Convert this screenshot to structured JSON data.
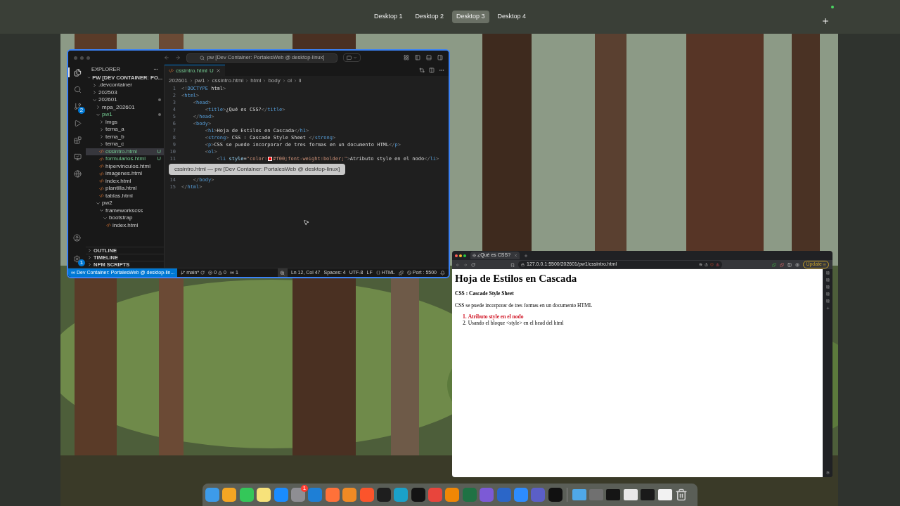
{
  "spaces": [
    {
      "label": "Desktop 1",
      "selected": false
    },
    {
      "label": "Desktop 2",
      "selected": false
    },
    {
      "label": "Desktop 3",
      "selected": true
    },
    {
      "label": "Desktop 4",
      "selected": false
    }
  ],
  "vscode": {
    "command_center": "pw [Dev Container: PortalesWeb @ desktop-linux]",
    "activity_bar": [
      {
        "kind": "files",
        "selected": true
      },
      {
        "kind": "search",
        "selected": false
      },
      {
        "kind": "source-control",
        "selected": false,
        "badge": "2"
      },
      {
        "kind": "run",
        "selected": false
      },
      {
        "kind": "extensions",
        "selected": false
      },
      {
        "kind": "remote",
        "selected": false
      },
      {
        "kind": "browser",
        "selected": false
      }
    ],
    "activity_bottom": [
      {
        "kind": "account"
      },
      {
        "kind": "settings",
        "badge": "1"
      }
    ],
    "explorer": {
      "title": "EXPLORER",
      "root": "PW [DEV CONTAINER: PO...",
      "tree": [
        {
          "label": ".devcontainer",
          "kind": "folder",
          "expanded": false,
          "selected": false
        },
        {
          "label": "202503",
          "kind": "folder",
          "expanded": false,
          "selected": false
        },
        {
          "label": "202601",
          "kind": "folder",
          "expanded": true,
          "selected": false,
          "dot": true,
          "children": [
            {
              "label": "mpa_202601",
              "kind": "folder",
              "expanded": false,
              "selected": false
            },
            {
              "label": "pw1",
              "kind": "folder",
              "expanded": true,
              "selected": false,
              "dot": true,
              "untracked": true,
              "children": [
                {
                  "label": "imgs",
                  "kind": "folder",
                  "expanded": false,
                  "selected": false
                },
                {
                  "label": "tema_a",
                  "kind": "folder",
                  "expanded": false,
                  "selected": false
                },
                {
                  "label": "tema_b",
                  "kind": "folder",
                  "expanded": false,
                  "selected": false
                },
                {
                  "label": "tema_c",
                  "kind": "folder",
                  "expanded": false,
                  "selected": false
                },
                {
                  "label": "cssintro.html",
                  "kind": "file",
                  "selected": true,
                  "untracked": true,
                  "status": "U"
                },
                {
                  "label": "formularios.html",
                  "kind": "file",
                  "selected": false,
                  "untracked": true,
                  "status": "U"
                },
                {
                  "label": "hipervinculos.html",
                  "kind": "file",
                  "selected": false
                },
                {
                  "label": "imagenes.html",
                  "kind": "file",
                  "selected": false
                },
                {
                  "label": "index.html",
                  "kind": "file",
                  "selected": false
                },
                {
                  "label": "plantilla.html",
                  "kind": "file",
                  "selected": false
                },
                {
                  "label": "tablas.html",
                  "kind": "file",
                  "selected": false
                }
              ]
            },
            {
              "label": "pw2",
              "kind": "folder",
              "expanded": true,
              "selected": false,
              "children": [
                {
                  "label": "frameworkscss",
                  "kind": "folder",
                  "expanded": true,
                  "selected": false,
                  "children": [
                    {
                      "label": "bootstrap",
                      "kind": "folder",
                      "expanded": true,
                      "selected": false,
                      "children": [
                        {
                          "label": "index.html",
                          "kind": "file",
                          "selected": false
                        }
                      ]
                    }
                  ]
                }
              ]
            }
          ]
        }
      ],
      "sections": [
        "OUTLINE",
        "TIMELINE",
        "NPM SCRIPTS"
      ]
    },
    "tab": {
      "label": "cssintro.html",
      "status": "U"
    },
    "breadcrumbs": [
      "202601",
      "pw1",
      "cssintro.html",
      "html",
      "body",
      "ol",
      "li"
    ],
    "lines": [
      {
        "kind": "code",
        "number": "1",
        "tokens": [
          {
            "kind": "punct",
            "t": "<!"
          },
          {
            "kind": "tag",
            "t": "DOCTYPE"
          },
          {
            "kind": "text",
            "t": " html"
          },
          {
            "kind": "punct",
            "t": ">"
          }
        ]
      },
      {
        "kind": "code",
        "number": "2",
        "tokens": [
          {
            "kind": "punct",
            "t": "<"
          },
          {
            "kind": "tag",
            "t": "html"
          },
          {
            "kind": "punct",
            "t": ">"
          }
        ]
      },
      {
        "kind": "code",
        "number": "3",
        "tokens": [
          {
            "kind": "punct",
            "t": "    <"
          },
          {
            "kind": "tag",
            "t": "head"
          },
          {
            "kind": "punct",
            "t": ">"
          }
        ]
      },
      {
        "kind": "code",
        "number": "4",
        "tokens": [
          {
            "kind": "punct",
            "t": "        <"
          },
          {
            "kind": "tag",
            "t": "title"
          },
          {
            "kind": "punct",
            "t": ">"
          },
          {
            "kind": "text",
            "t": "¿Qué es CSS?"
          },
          {
            "kind": "punct",
            "t": "</"
          },
          {
            "kind": "tag",
            "t": "title"
          },
          {
            "kind": "punct",
            "t": ">"
          }
        ]
      },
      {
        "kind": "code",
        "number": "5",
        "tokens": [
          {
            "kind": "punct",
            "t": "    </"
          },
          {
            "kind": "tag",
            "t": "head"
          },
          {
            "kind": "punct",
            "t": ">"
          }
        ]
      },
      {
        "kind": "code",
        "number": "6",
        "tokens": [
          {
            "kind": "punct",
            "t": "    <"
          },
          {
            "kind": "tag",
            "t": "body"
          },
          {
            "kind": "punct",
            "t": ">"
          }
        ]
      },
      {
        "kind": "code",
        "number": "7",
        "tokens": [
          {
            "kind": "punct",
            "t": "        <"
          },
          {
            "kind": "tag",
            "t": "h1"
          },
          {
            "kind": "punct",
            "t": ">"
          },
          {
            "kind": "text",
            "t": "Hoja de Estilos en Cascada"
          },
          {
            "kind": "punct",
            "t": "</"
          },
          {
            "kind": "tag",
            "t": "h1"
          },
          {
            "kind": "punct",
            "t": ">"
          }
        ]
      },
      {
        "kind": "code",
        "number": "8",
        "tokens": [
          {
            "kind": "punct",
            "t": "        <"
          },
          {
            "kind": "tag",
            "t": "strong"
          },
          {
            "kind": "punct",
            "t": ">"
          },
          {
            "kind": "text",
            "t": " CSS : Cascade Style Sheet "
          },
          {
            "kind": "punct",
            "t": "</"
          },
          {
            "kind": "tag",
            "t": "strong"
          },
          {
            "kind": "punct",
            "t": ">"
          }
        ]
      },
      {
        "kind": "code",
        "number": "9",
        "tokens": [
          {
            "kind": "punct",
            "t": "        <"
          },
          {
            "kind": "tag",
            "t": "p"
          },
          {
            "kind": "punct",
            "t": ">"
          },
          {
            "kind": "text",
            "t": "CSS se puede incorporar de tres formas en un documento HTML"
          },
          {
            "kind": "punct",
            "t": "</"
          },
          {
            "kind": "tag",
            "t": "p"
          },
          {
            "kind": "punct",
            "t": ">"
          }
        ]
      },
      {
        "kind": "code",
        "number": "10",
        "tokens": [
          {
            "kind": "punct",
            "t": "        <"
          },
          {
            "kind": "tag",
            "t": "ol"
          },
          {
            "kind": "punct",
            "t": ">"
          }
        ]
      },
      {
        "kind": "code",
        "number": "11",
        "tokens": [
          {
            "kind": "punct",
            "t": "            <"
          },
          {
            "kind": "tag",
            "t": "li"
          },
          {
            "kind": "attr",
            "t": " style"
          },
          {
            "kind": "text",
            "t": "="
          },
          {
            "kind": "str",
            "t": "\"color:"
          },
          {
            "kind": "swatch",
            "color": "#ff0000"
          },
          {
            "kind": "str",
            "t": "#f00;font-weight:bolder;\""
          },
          {
            "kind": "punct",
            "t": ">"
          },
          {
            "kind": "text",
            "t": "Atributo style en el nodo"
          },
          {
            "kind": "punct",
            "t": "</"
          },
          {
            "kind": "tag",
            "t": "li"
          },
          {
            "kind": "punct",
            "t": ">"
          }
        ]
      },
      {
        "kind": "tooltip",
        "text": "cssintro.html — pw [Dev Container: PortalesWeb @ desktop-linux]"
      },
      {
        "kind": "code",
        "number": "14",
        "tokens": [
          {
            "kind": "punct",
            "t": "    </"
          },
          {
            "kind": "tag",
            "t": "body"
          },
          {
            "kind": "punct",
            "t": ">"
          }
        ]
      },
      {
        "kind": "code",
        "number": "15",
        "tokens": [
          {
            "kind": "punct",
            "t": "</"
          },
          {
            "kind": "tag",
            "t": "html"
          },
          {
            "kind": "punct",
            "t": ">"
          }
        ]
      }
    ],
    "status_bar": {
      "remote": "Dev Container: PortalesWeb @ desktop-lin...",
      "branch": "main*",
      "errors": "0",
      "warnings": "0",
      "ports": "1",
      "position": "Ln 12, Col 47",
      "spaces": "Spaces: 4",
      "encoding": "UTF-8",
      "eol": "LF",
      "language": "HTML",
      "port": "Port : 5500"
    }
  },
  "browser": {
    "tab": "¿Qué es CSS?",
    "url": "127.0.0.1:5500/202601/pw1/cssintro.html",
    "update": "Update",
    "page": {
      "heading": "Hoja de Estilos en Cascada",
      "strong": "CSS : Cascade Style Sheet",
      "paragraph": "CSS se puede incorporar de tres formas en un documento HTML",
      "list": [
        {
          "number": "1.",
          "text": "Atributo style en el nodo",
          "kind": "styled"
        },
        {
          "number": "2.",
          "text": "Usando el bloque <style> en el head del html",
          "kind": "plain"
        }
      ]
    }
  },
  "dock": {
    "apps": [
      {
        "color": "#3d9be9"
      },
      {
        "color": "#f5a623"
      },
      {
        "color": "#34c759"
      },
      {
        "color": "#f7e27a"
      },
      {
        "color": "#1a8cff"
      },
      {
        "color": "#8e8e93",
        "badge": "1"
      },
      {
        "color": "#1e7fd6"
      },
      {
        "color": "#ff7139"
      },
      {
        "color": "#f08a24"
      },
      {
        "color": "#fb542b"
      },
      {
        "color": "#1e1e1e"
      },
      {
        "color": "#1aa1c9"
      },
      {
        "color": "#141414"
      },
      {
        "color": "#e8453c"
      },
      {
        "color": "#f08705"
      },
      {
        "color": "#1f7244"
      },
      {
        "color": "#7c5ad6"
      },
      {
        "color": "#2b66c8"
      },
      {
        "color": "#2d8cff"
      },
      {
        "color": "#5b5fc7"
      },
      {
        "color": "#111111"
      }
    ],
    "windows": [
      {
        "color": "#4fa8e8"
      },
      {
        "color": "#707070"
      },
      {
        "color": "#151515"
      },
      {
        "color": "#e8e8e8"
      },
      {
        "color": "#1a1a1a"
      },
      {
        "color": "#f2f2f2"
      }
    ]
  }
}
